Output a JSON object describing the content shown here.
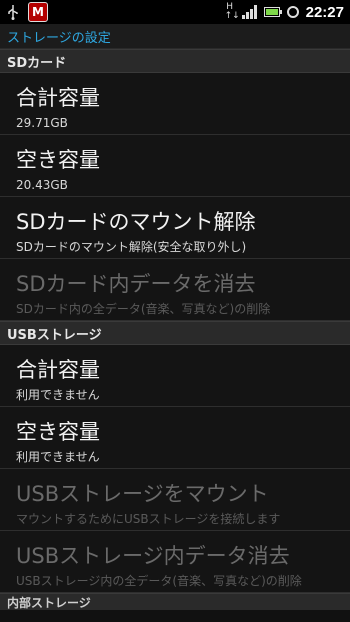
{
  "statusbar": {
    "time": "22:27",
    "network_type": "H",
    "icons": [
      "usb-icon",
      "mcafee-icon",
      "hsdpa-icon",
      "signal-icon",
      "battery-icon",
      "alarm-icon"
    ],
    "mcafee_label": "M",
    "battery_color": "#7fd84a"
  },
  "title": "ストレージの設定",
  "accent_color": "#2ea7e0",
  "sections": {
    "sd": {
      "header": "SDカード",
      "total": {
        "title": "合計容量",
        "value": "29.71GB"
      },
      "free": {
        "title": "空き容量",
        "value": "20.43GB"
      },
      "unmount": {
        "title": "SDカードのマウント解除",
        "summary": "SDカードのマウント解除(安全な取り外し)"
      },
      "erase": {
        "title": "SDカード内データを消去",
        "summary": "SDカード内の全データ(音楽、写真など)の削除"
      }
    },
    "usb": {
      "header": "USBストレージ",
      "total": {
        "title": "合計容量",
        "value": "利用できません"
      },
      "free": {
        "title": "空き容量",
        "value": "利用できません"
      },
      "mount": {
        "title": "USBストレージをマウント",
        "summary": "マウントするためにUSBストレージを接続します"
      },
      "erase": {
        "title": "USBストレージ内データ消去",
        "summary": "USBストレージ内の全データ(音楽、写真など)の削除"
      }
    },
    "internal": {
      "header": "内部ストレージ"
    }
  }
}
